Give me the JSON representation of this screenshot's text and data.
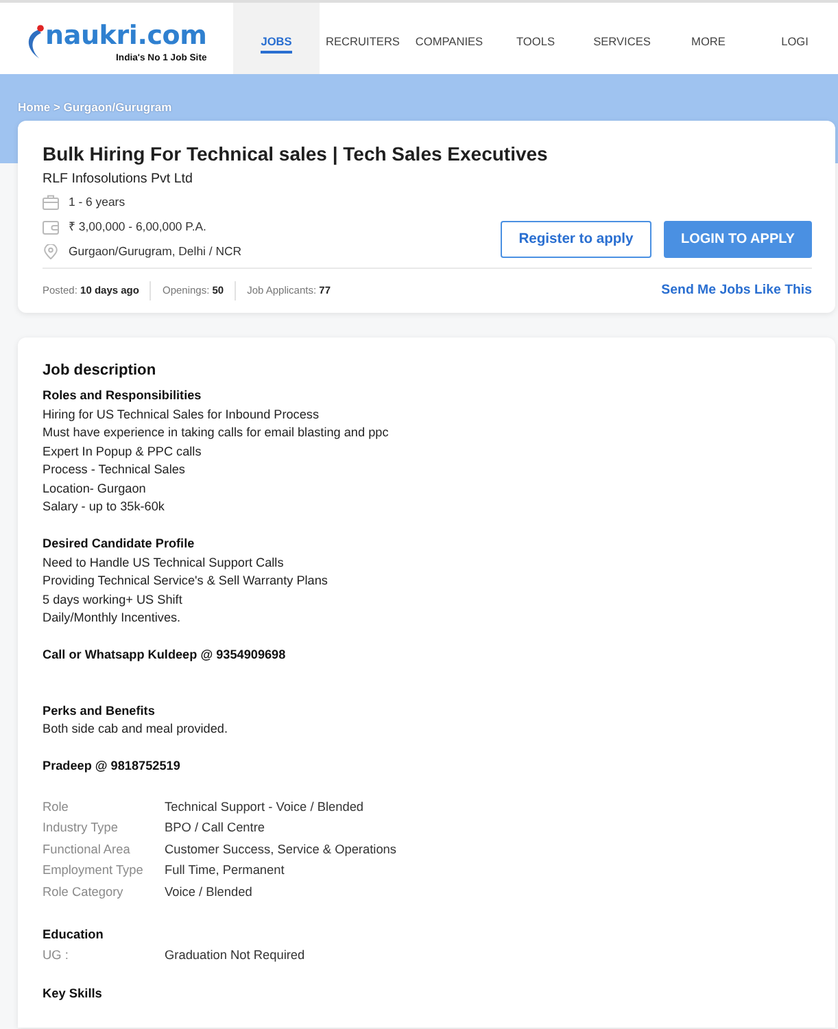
{
  "header": {
    "logo": {
      "text": "naukri.com",
      "tagline": "India's No 1 Job Site"
    },
    "nav": [
      {
        "label": "JOBS",
        "selected": true
      },
      {
        "label": "RECRUITERS",
        "selected": false
      },
      {
        "label": "COMPANIES",
        "selected": false
      },
      {
        "label": "TOOLS",
        "selected": false
      },
      {
        "label": "SERVICES",
        "selected": false
      },
      {
        "label": "MORE",
        "selected": false
      },
      {
        "label": "LOGI",
        "selected": false
      }
    ]
  },
  "breadcrumb": "Home > Gurgaon/Gurugram",
  "job": {
    "title": "Bulk Hiring For Technical sales | Tech Sales Executives",
    "company": "RLF Infosolutions Pvt Ltd",
    "facts": [
      {
        "kind": "experience",
        "text": "1 - 6 years"
      },
      {
        "kind": "salary",
        "text": "₹ 3,00,000 - 6,00,000 P.A."
      },
      {
        "kind": "location",
        "text": "Gurgaon/Gurugram, Delhi / NCR"
      }
    ],
    "actions": [
      {
        "kind": "outline",
        "label": "Register to apply"
      },
      {
        "kind": "filled",
        "label": "LOGIN TO APPLY"
      }
    ],
    "stats": [
      "Posted: **10 days ago**",
      "Openings: **50**",
      "Job Applicants: **77**"
    ],
    "link": "Send Me Jobs Like This"
  },
  "description": {
    "heading": "Job description",
    "sections": [
      {
        "title": "Roles and Responsibilities",
        "lines": [
          "Hiring for US Technical Sales for Inbound Process",
          "Must have experience in taking calls for email blasting and ppc",
          "Expert In Popup & PPC calls",
          "Process - Technical Sales",
          "Location- Gurgaon",
          "Salary - up to 35k-60k"
        ]
      },
      {
        "title": "Desired Candidate Profile",
        "lines": [
          "Need to Handle US Technical Support Calls",
          "Providing Technical Service's & Sell Warranty Plans",
          "5 days working+ US Shift",
          "Daily/Monthly Incentives."
        ]
      },
      {
        "title": "Call or Whatsapp Kuldeep @ 9354909698"
      },
      {
        "title": "Perks and Benefits",
        "lines": [
          "Both side cab and meal provided."
        ]
      },
      {
        "title": "Pradeep @ 9818752519"
      }
    ],
    "details": [
      {
        "label": "Role",
        "value": "Technical Support - Voice / Blended"
      },
      {
        "label": "Industry Type",
        "value": "BPO / Call Centre"
      },
      {
        "label": "Functional Area",
        "value": "Customer Success, Service & Operations"
      },
      {
        "label": "Employment Type",
        "value": "Full Time, Permanent"
      },
      {
        "label": "Role Category",
        "value": "Voice / Blended"
      }
    ],
    "education": {
      "heading": "Education",
      "rows": [
        {
          "label": "UG :",
          "value": "Graduation Not Required"
        }
      ]
    },
    "skills": {
      "heading": "Key Skills"
    }
  }
}
